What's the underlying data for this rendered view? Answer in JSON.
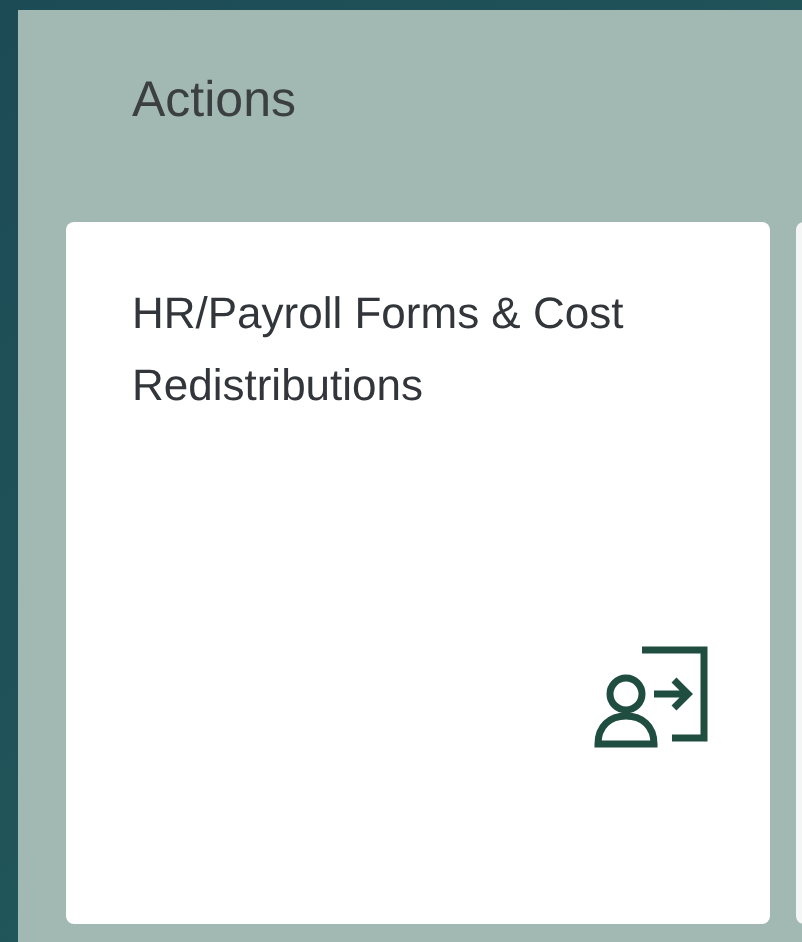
{
  "section": {
    "title": "Actions"
  },
  "tiles": [
    {
      "title": "HR/Payroll Forms & Cost Redistributions",
      "kind": "launch"
    }
  ]
}
